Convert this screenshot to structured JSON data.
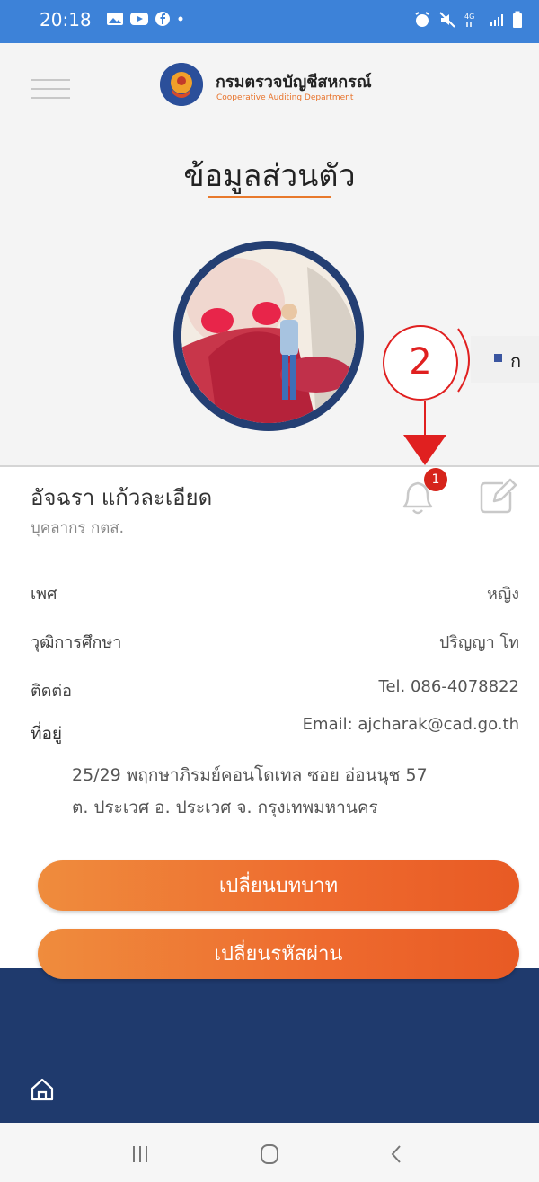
{
  "status_bar": {
    "time": "20:18"
  },
  "header": {
    "org_name_th": "กรมตรวจบัญชีสหกรณ์",
    "org_name_en": "Cooperative Auditing Department"
  },
  "page_title": "ข้อมูลส่วนตัว",
  "annotation": {
    "number": "2",
    "text": "ก"
  },
  "profile": {
    "name": "อัจฉรา แก้วละเอียด",
    "role": "บุคลากร กตส.",
    "notification_count": "1",
    "fields": [
      {
        "label": "เพศ",
        "value": "หญิง"
      },
      {
        "label": "วุฒิการศึกษา",
        "value": "ปริญญา โท"
      },
      {
        "label": "ติดต่อ",
        "value": "Tel. 086-4078822"
      }
    ],
    "email": "Email: ajcharak@cad.go.th",
    "address_label": "ที่อยู่",
    "address_line1": "25/29 พฤกษาภิรมย์คอนโดเทล ซอย อ่อนนุช 57",
    "address_line2": "ต. ประเวศ อ. ประเวศ จ. กรุงเทพมหานคร"
  },
  "buttons": {
    "change_role": "เปลี่ยนบทบาท",
    "change_password": "เปลี่ยนรหัสผ่าน"
  },
  "colors": {
    "status_bar": "#3d82d8",
    "accent": "#ee6a2e",
    "footer": "#1f3a6d",
    "badge": "#d6241b",
    "annotation": "#e02020"
  }
}
